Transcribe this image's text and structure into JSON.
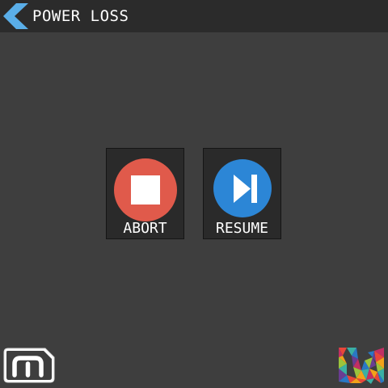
{
  "header": {
    "title": "POWER LOSS",
    "back_icon": "chevron-left-icon",
    "back_color": "#5aaee8"
  },
  "actions": [
    {
      "label": "ABORT",
      "icon": "stop-icon",
      "color": "#e05a4b"
    },
    {
      "label": "RESUME",
      "icon": "skip-forward-icon",
      "color": "#2c86d6"
    }
  ],
  "footer": {
    "left_logo": "m-logo-icon",
    "right_logo": "brand-logo-icon"
  }
}
